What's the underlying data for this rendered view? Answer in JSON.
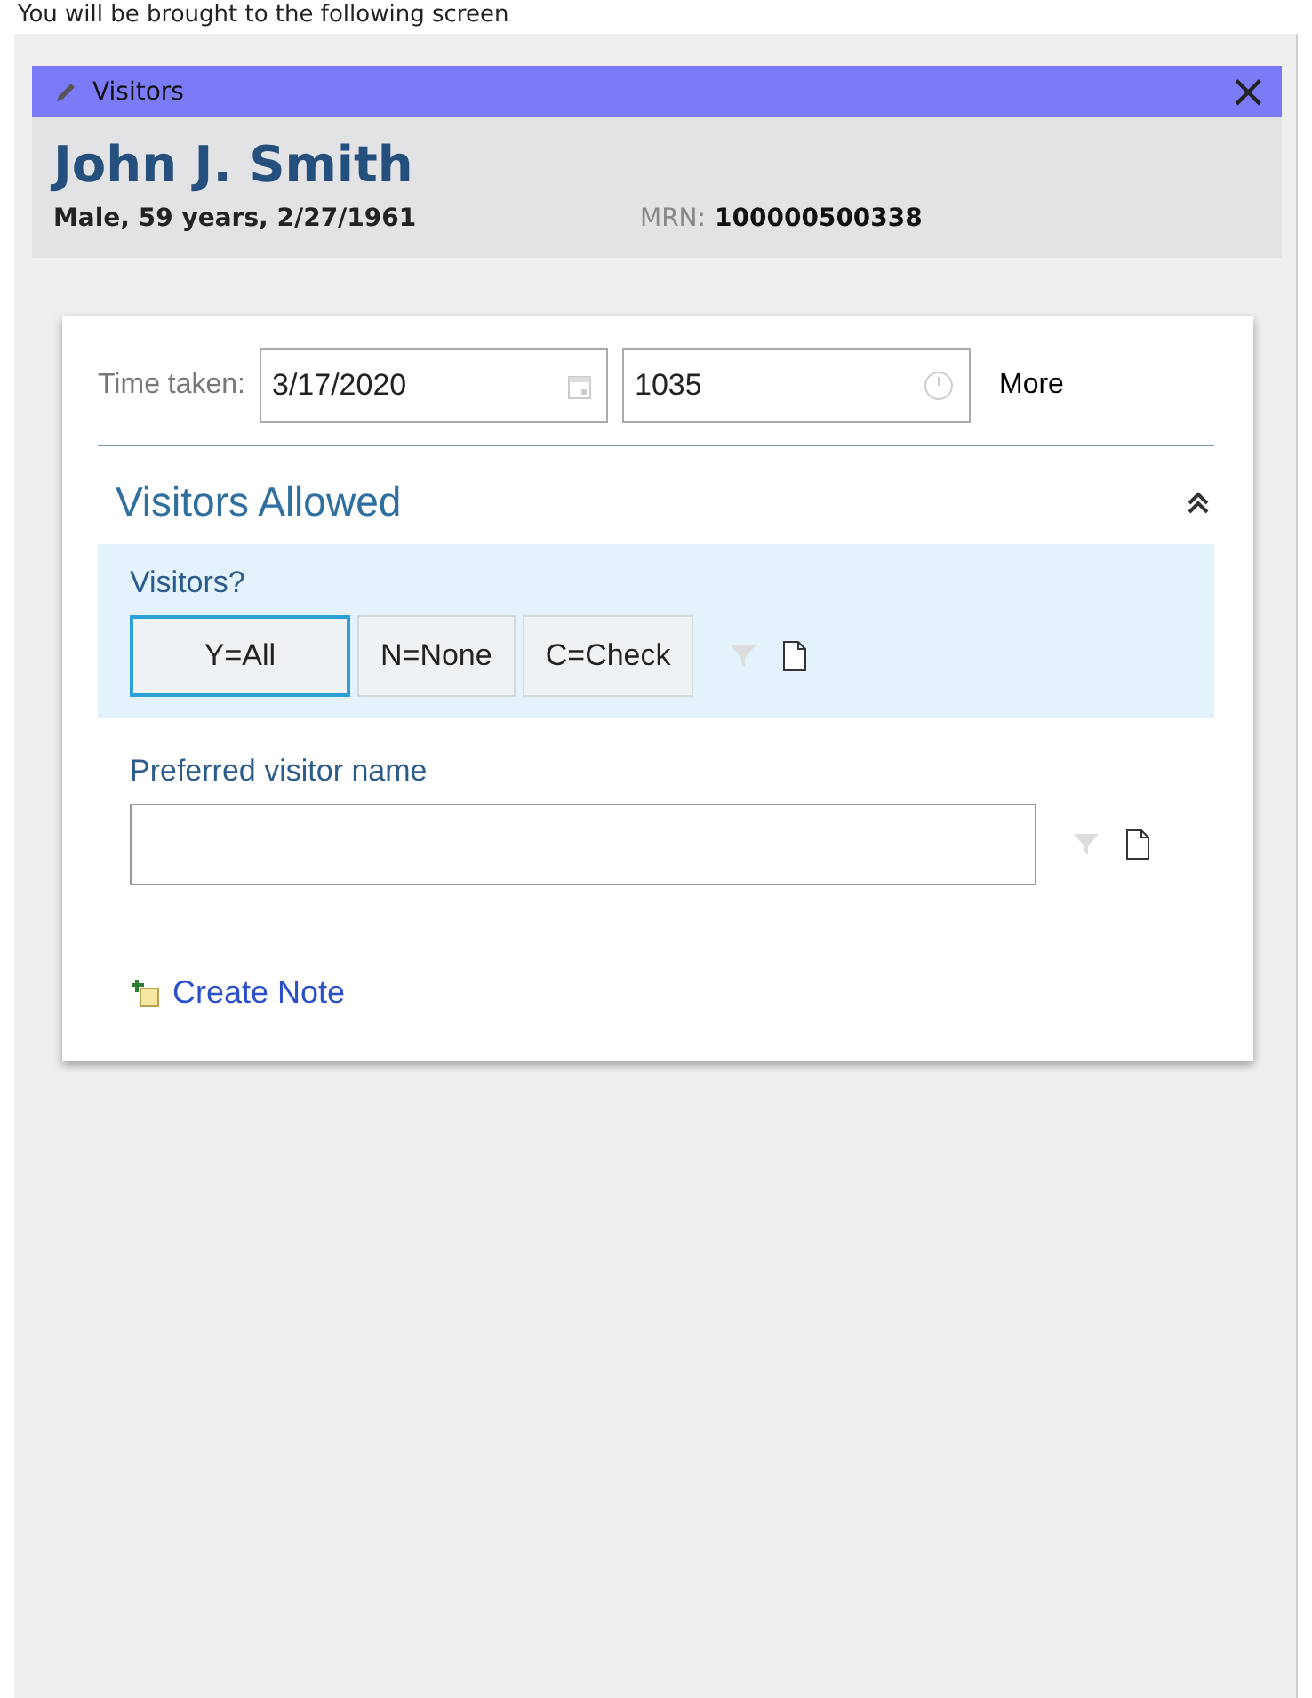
{
  "caption": "You will be brought to the following screen",
  "window": {
    "title": "Visitors",
    "close": "×"
  },
  "patient": {
    "name": "John J. Smith",
    "details": "Male, 59 years, 2/27/1961",
    "mrn_label": "MRN:",
    "mrn": "100000500338"
  },
  "time_taken": {
    "label": "Time taken:",
    "date": "3/17/2020",
    "time": "1035",
    "more": "More"
  },
  "section": {
    "title": "Visitors Allowed",
    "expanded": true
  },
  "visitors_question": {
    "label": "Visitors?",
    "options": [
      {
        "label": "Y=All",
        "selected": true
      },
      {
        "label": "N=None",
        "selected": false
      },
      {
        "label": "C=Check",
        "selected": false
      }
    ]
  },
  "preferred_name": {
    "label": "Preferred visitor name"
  },
  "create_note": "Create Note"
}
